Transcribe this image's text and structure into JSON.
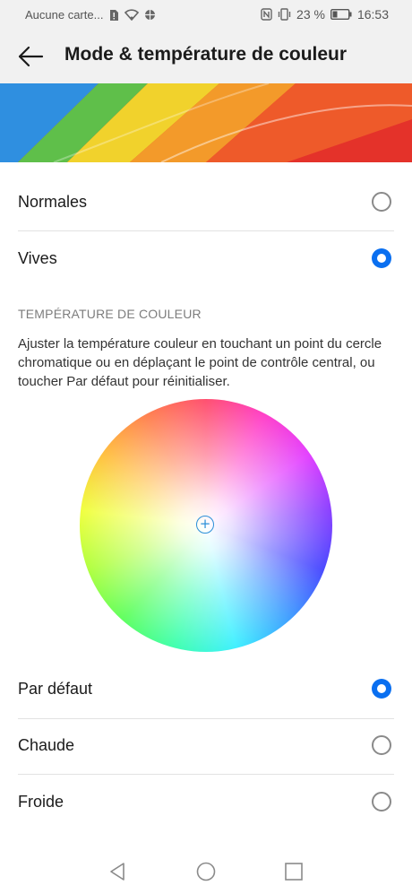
{
  "status_bar": {
    "carrier": "Aucune carte...",
    "battery": "23 %",
    "time": "16:53",
    "icons": [
      "sim-alert-icon",
      "wifi-icon",
      "data-saver-icon",
      "nfc-icon",
      "vibrate-icon",
      "battery-icon"
    ]
  },
  "app_bar": {
    "back_icon": "back-arrow-icon",
    "title": "Mode & température de couleur"
  },
  "modes": [
    {
      "label": "Normales",
      "selected": false
    },
    {
      "label": "Vives",
      "selected": true
    }
  ],
  "temperature": {
    "header": "TEMPÉRATURE DE COULEUR",
    "description": "Ajuster la température couleur en touchant un point du cercle chromatique ou en déplaçant le point de contrôle central, ou toucher Par défaut pour réinitialiser.",
    "handle_symbol": "+",
    "options": [
      {
        "label": "Par défaut",
        "selected": true
      },
      {
        "label": "Chaude",
        "selected": false
      },
      {
        "label": "Froide",
        "selected": false
      }
    ]
  },
  "colors": {
    "accent": "#0a6ff0",
    "background": "#ffffff",
    "bar_background": "#f1f1f1"
  },
  "nav_bar": {
    "icons": [
      "back-triangle-icon",
      "home-circle-icon",
      "recents-square-icon"
    ]
  }
}
